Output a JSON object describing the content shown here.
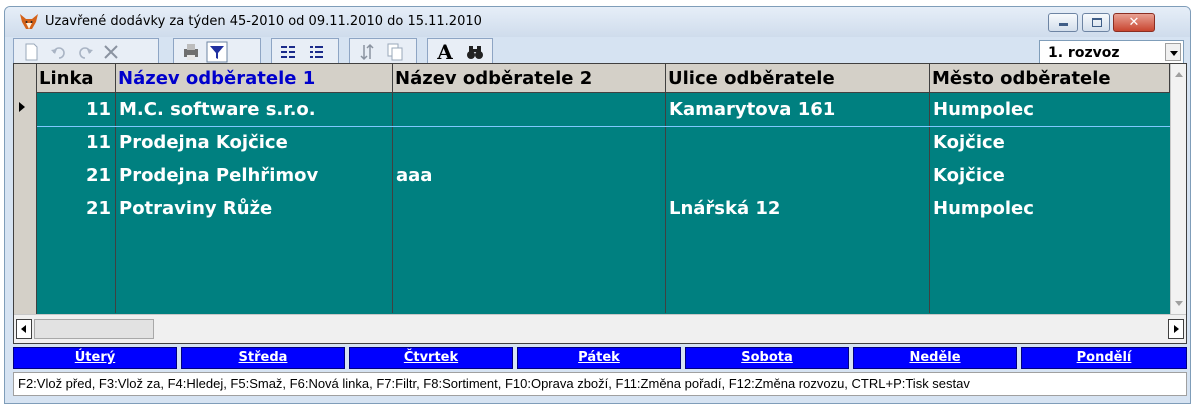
{
  "window": {
    "title": "Uzavřené dodávky za týden 45-2010 od 09.11.2010 do 15.11.2010",
    "app_icon": "fox-icon",
    "controls": {
      "minimize": "minimize-icon",
      "maximize": "maximize-icon",
      "close": "✕"
    }
  },
  "toolbar": {
    "buttons": [
      {
        "name": "new-icon"
      },
      {
        "name": "undo-icon"
      },
      {
        "name": "redo-icon"
      },
      {
        "name": "delete-icon"
      },
      {
        "name": "print-icon"
      },
      {
        "name": "filter-icon"
      },
      {
        "name": "grid-view-icon"
      },
      {
        "name": "list-view-icon"
      },
      {
        "name": "sort-icon"
      },
      {
        "name": "copy-icon"
      },
      {
        "name": "font-icon",
        "label": "A"
      },
      {
        "name": "binoculars-icon"
      }
    ],
    "rozvoz_selected": "1. rozvoz"
  },
  "grid": {
    "columns": [
      "Linka",
      "Název odběratele 1",
      "Název odběratele 2",
      "Ulice odběratele",
      "Město odběratele"
    ],
    "active_column": 1,
    "rows": [
      {
        "linka": "11",
        "nazev1": "M.C. software s.r.o.",
        "nazev2": "",
        "ulice": "Kamarytova 161",
        "mesto": "Humpolec"
      },
      {
        "linka": "11",
        "nazev1": "Prodejna Kojčice",
        "nazev2": "",
        "ulice": "",
        "mesto": "Kojčice"
      },
      {
        "linka": "21",
        "nazev1": "Prodejna Pelhřimov",
        "nazev2": "aaa",
        "ulice": "",
        "mesto": "Kojčice"
      },
      {
        "linka": "21",
        "nazev1": "Potraviny Růže",
        "nazev2": "",
        "ulice": "Lnářská 12",
        "mesto": "Humpolec"
      }
    ]
  },
  "days": [
    "Úterý",
    "Středa",
    "Čtvrtek",
    "Pátek",
    "Sobota",
    "Neděle",
    "Pondělí"
  ],
  "status": "F2:Vlož před, F3:Vlož za, F4:Hledej, F5:Smaž, F6:Nová linka, F7:Filtr, F8:Sortiment, F10:Oprava zboží, F11:Změna pořadí, F12:Změna rozvozu, CTRL+P:Tisk sestav",
  "colors": {
    "grid_bg": "#008080",
    "day_button": "#0000ff",
    "active_header": "#0000cc"
  }
}
